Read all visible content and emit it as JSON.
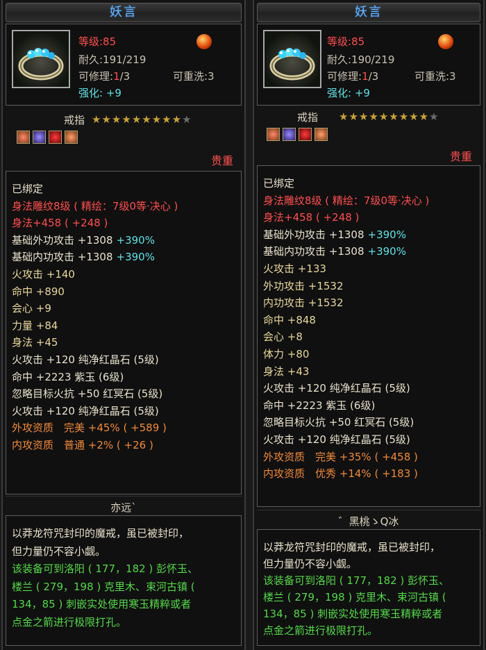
{
  "panels": [
    {
      "title": "妖言",
      "level": "等级:85",
      "durability": "耐久:191/219",
      "repair_label": "可修理:",
      "repair_current": "1",
      "repair_total": "/3",
      "rewash": "可重洗:3",
      "enhance_label": "强化:",
      "enhance_value": "+9",
      "type": "戒指",
      "stars_on": 9,
      "stars_total": 10,
      "quality": "贵重",
      "lines": [
        {
          "text": "已绑定",
          "color": "w"
        },
        {
          "text": "身法雕纹8级 ( 精绘：7级0等·决心 )",
          "color": "r"
        },
        {
          "text": "身法+458 ( +248 )",
          "color": "r"
        },
        {
          "text": "基础外功攻击 +1308",
          "extra": "+390%",
          "color": "w"
        },
        {
          "text": "基础内功攻击 +1308",
          "extra": "+390%",
          "color": "w"
        },
        {
          "text": "火攻击 +140",
          "color": "y"
        },
        {
          "text": "命中 +890",
          "color": "y"
        },
        {
          "text": "会心 +9",
          "color": "y"
        },
        {
          "text": "力量 +84",
          "color": "y"
        },
        {
          "text": "身法 +45",
          "color": "y"
        },
        {
          "text": "火攻击 +120 纯净红晶石 (5级)",
          "color": "w"
        },
        {
          "text": "命中 +2223 紫玉 (6级)",
          "color": "w"
        },
        {
          "text": "忽略目标火抗 +50 红冥石 (5级)",
          "color": "w"
        },
        {
          "text": "火攻击 +120 纯净红晶石 (5级)",
          "color": "w"
        },
        {
          "text": "外攻资质　完美 +45% ( +589 )",
          "color": "o"
        },
        {
          "text": "内攻资质　普通 +2% ( +26 )",
          "color": "o"
        }
      ],
      "signature": "亦远`",
      "desc_lines": [
        {
          "text": "以莽龙符咒封印的魔戒，虽已被封印，",
          "color": "w"
        },
        {
          "text": "但力量仍不容小觑。",
          "color": "w"
        },
        {
          "text": "该装备可到洛阳 ( 177，182 ) 彭怀玉、",
          "color": "g"
        },
        {
          "text": "楼兰 ( 279，198 ) 克里木、束河古镇 (",
          "color": "g"
        },
        {
          "text": "134，85 ) 刺嵌实处使用寒玉精粹或者",
          "color": "g"
        },
        {
          "text": "点金之箭进行极限打孔。",
          "color": "g"
        }
      ]
    },
    {
      "title": "妖言",
      "level": "等级:85",
      "durability": "耐久:190/219",
      "repair_label": "可修理:",
      "repair_current": "1",
      "repair_total": "/3",
      "rewash": "可重洗:3",
      "enhance_label": "强化:",
      "enhance_value": "+9",
      "type": "戒指",
      "stars_on": 9,
      "stars_total": 10,
      "quality": "贵重",
      "lines": [
        {
          "text": "已绑定",
          "color": "w"
        },
        {
          "text": "身法雕纹8级 ( 精绘：7级0等·决心 )",
          "color": "r"
        },
        {
          "text": "身法+458 ( +248 )",
          "color": "r"
        },
        {
          "text": "基础外功攻击 +1308",
          "extra": "+390%",
          "color": "w"
        },
        {
          "text": "基础内功攻击 +1308",
          "extra": "+390%",
          "color": "w"
        },
        {
          "text": "火攻击 +133",
          "color": "y"
        },
        {
          "text": "外功攻击 +1532",
          "color": "y"
        },
        {
          "text": "内功攻击 +1532",
          "color": "y"
        },
        {
          "text": "命中 +848",
          "color": "y"
        },
        {
          "text": "会心 +8",
          "color": "y"
        },
        {
          "text": "体力 +80",
          "color": "y"
        },
        {
          "text": "身法 +43",
          "color": "y"
        },
        {
          "text": "火攻击 +120 纯净红晶石 (5级)",
          "color": "w"
        },
        {
          "text": "命中 +2223 紫玉 (6级)",
          "color": "w"
        },
        {
          "text": "忽略目标火抗 +50 红冥石 (5级)",
          "color": "w"
        },
        {
          "text": "火攻击 +120 纯净红晶石 (5级)",
          "color": "w"
        },
        {
          "text": "外攻资质　完美 +35% ( +458 )",
          "color": "o"
        },
        {
          "text": "内攻资质　优秀 +14% ( +183 )",
          "color": "o"
        }
      ],
      "signature": "゛黑桃ゝQ冰",
      "desc_lines": [
        {
          "text": "以莽龙符咒封印的魔戒，虽已被封印，",
          "color": "w"
        },
        {
          "text": "但力量仍不容小觑。",
          "color": "w"
        },
        {
          "text": "该装备可到洛阳 ( 177，182 ) 彭怀玉、",
          "color": "g"
        },
        {
          "text": "楼兰 ( 279，198 ) 克里木、束河古镇 (",
          "color": "g"
        },
        {
          "text": "134，85 ) 刺嵌实处使用寒玉精粹或者",
          "color": "g"
        },
        {
          "text": "点金之箭进行极限打孔。",
          "color": "g"
        }
      ]
    }
  ]
}
